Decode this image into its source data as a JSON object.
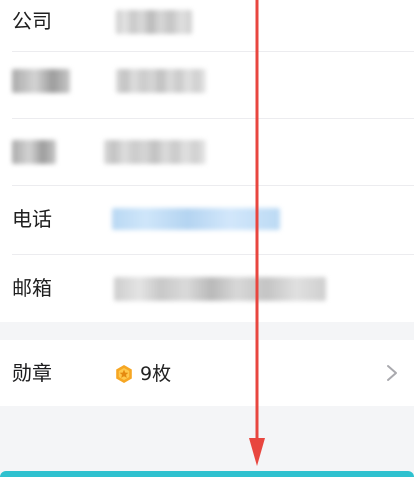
{
  "profile": {
    "rows": [
      {
        "label": "公司"
      },
      {
        "label": ""
      },
      {
        "label": ""
      },
      {
        "label": "电话"
      },
      {
        "label": "邮箱"
      }
    ]
  },
  "medal": {
    "label": "勋章",
    "count_text": "9枚",
    "icon": "medal-icon",
    "chevron": "chevron-right-icon"
  },
  "annotation": {
    "arrow_color": "#e8463f",
    "direction": "down"
  },
  "colors": {
    "background": "#f4f5f7",
    "card": "#ffffff",
    "accent_teal": "#2fc1cf",
    "medal_orange": "#f6a623"
  }
}
